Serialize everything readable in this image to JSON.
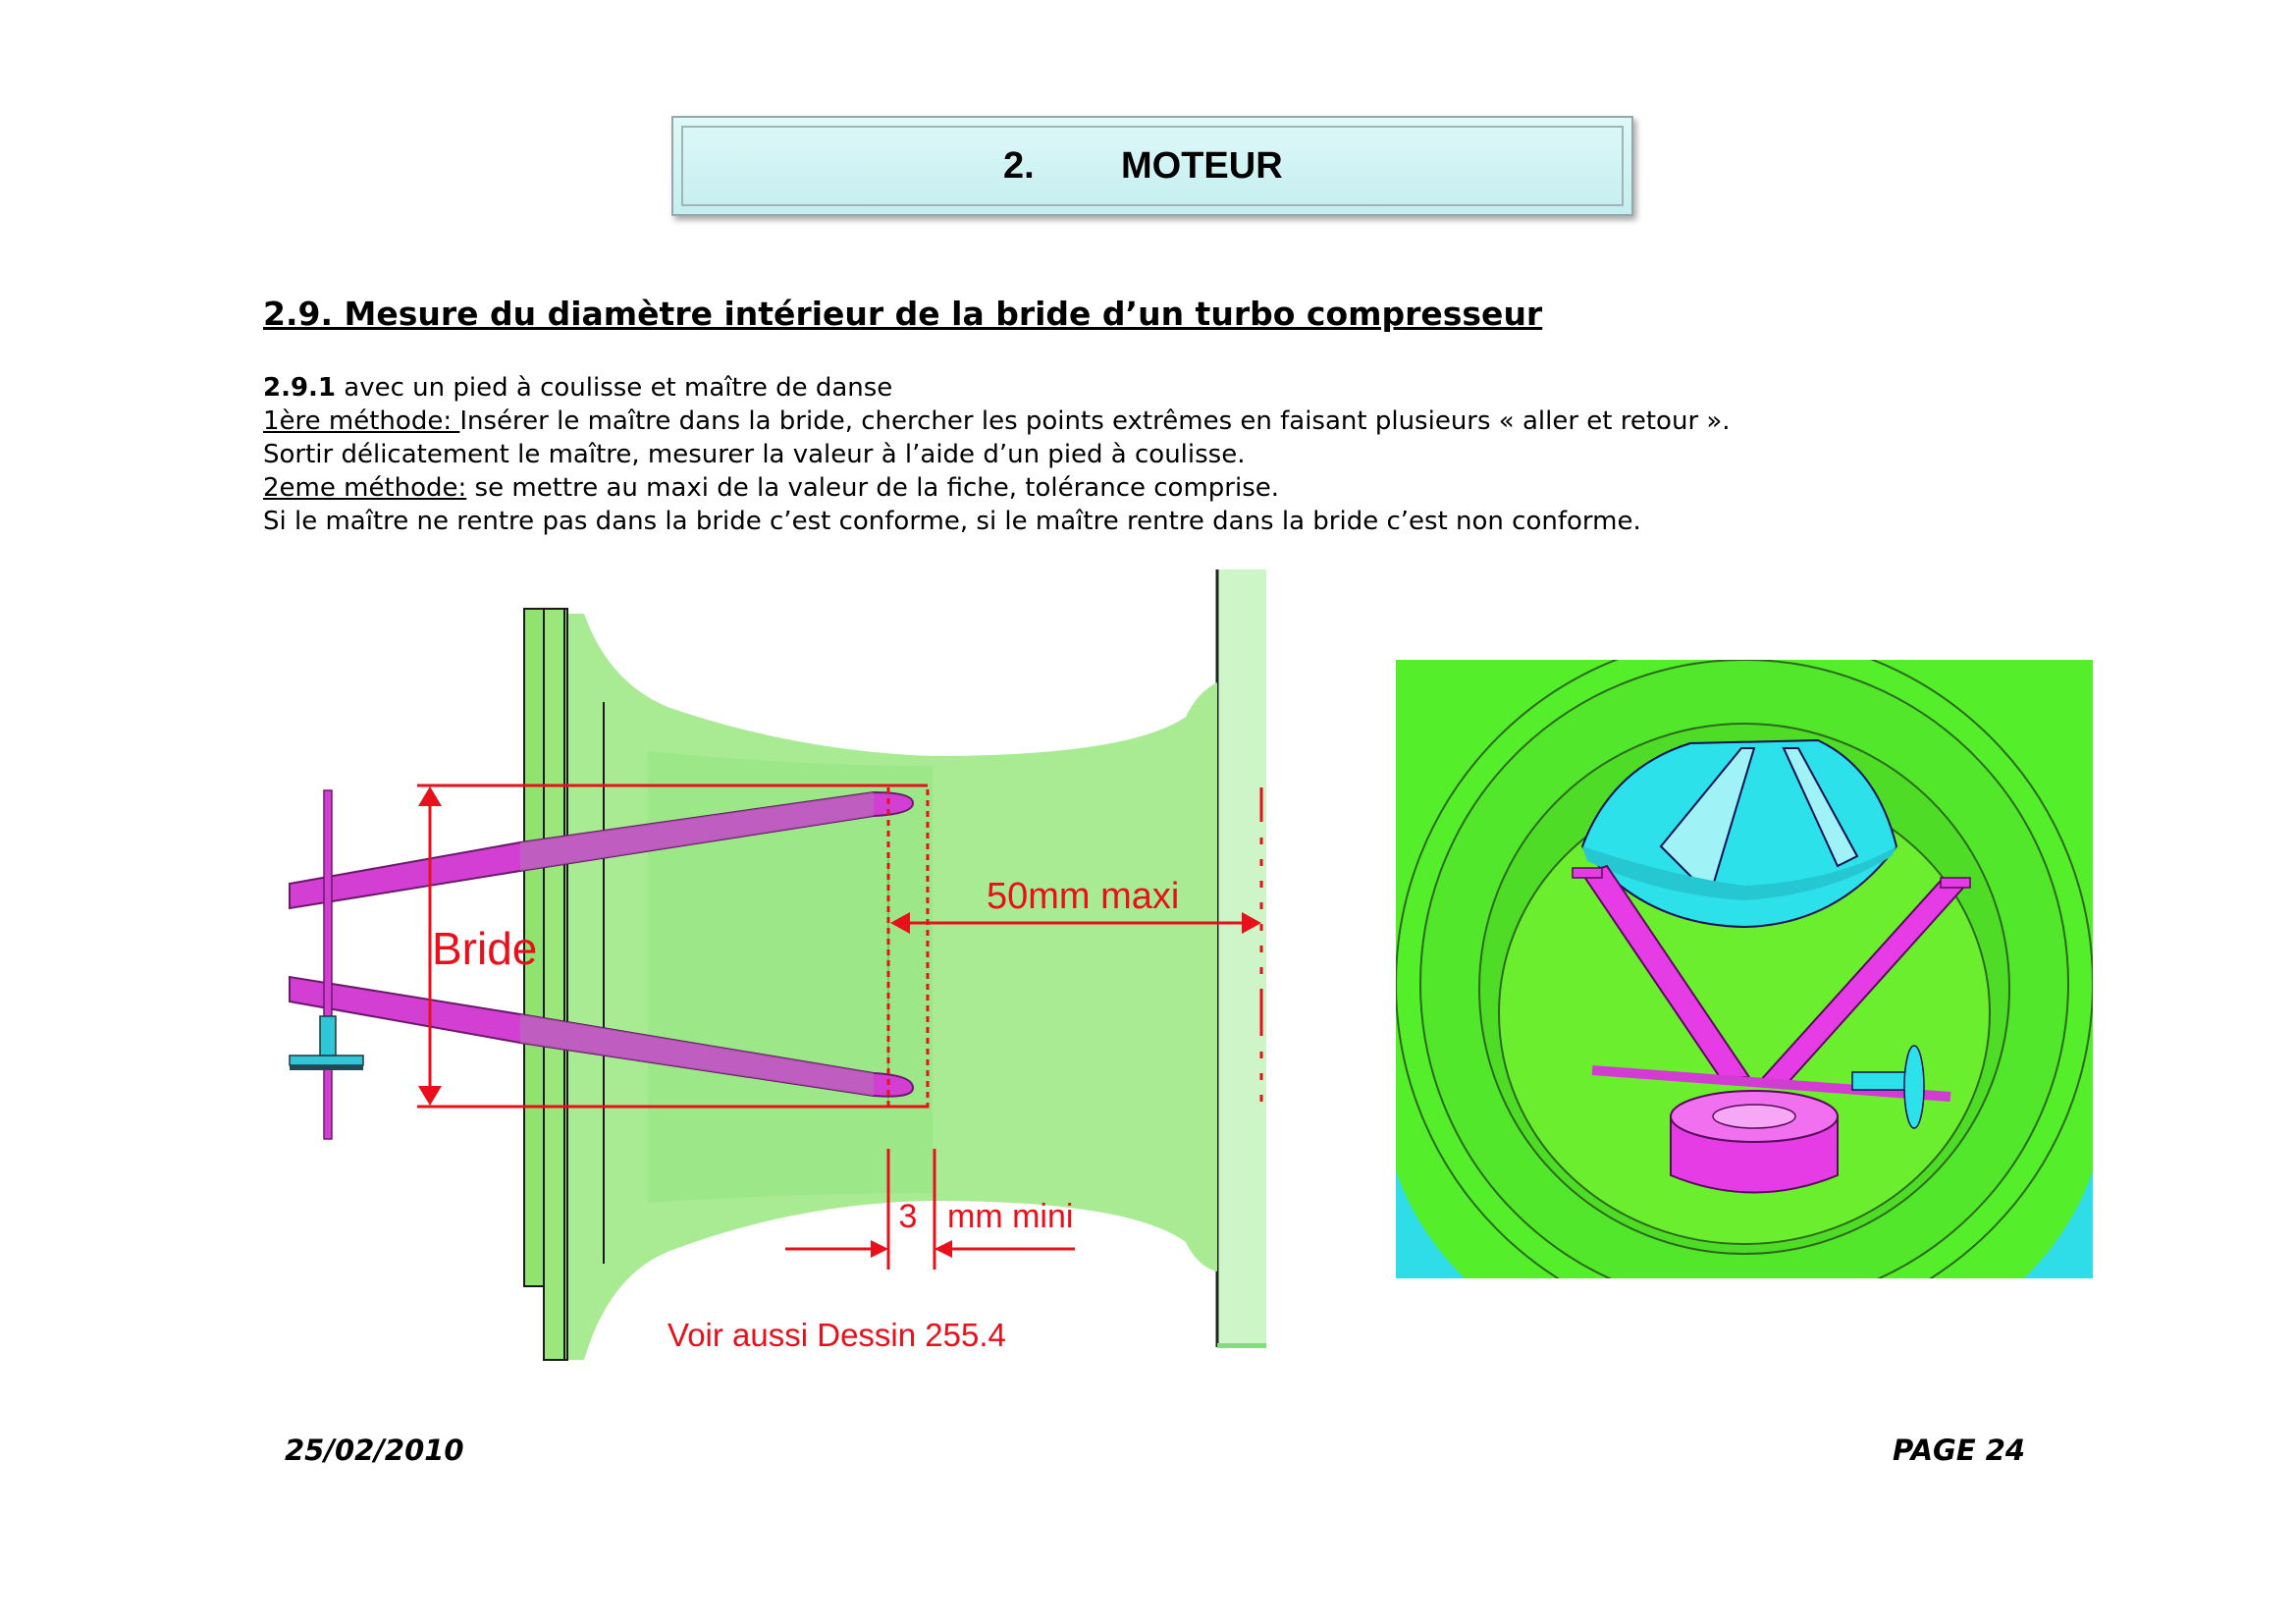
{
  "header": {
    "number": "2.",
    "title": "MOTEUR"
  },
  "section": {
    "title": "2.9. Mesure du diamètre intérieur de la bride d’un turbo compresseur"
  },
  "body": {
    "subsection_number": "2.9.1",
    "subsection_text": "avec un pied à coulisse et maître de danse",
    "method1_label": "1ère méthode: ",
    "method1_text": "Insérer le maître dans la bride, chercher les points extrêmes en faisant plusieurs « aller et retour ».",
    "line3": "Sortir délicatement le maître, mesurer la valeur à l’aide d’un pied à coulisse.",
    "method2_label": "2eme méthode:",
    "method2_text": " se mettre au maxi de la valeur de la fiche, tolérance comprise.",
    "line5": " Si le maître ne rentre pas dans la bride c’est conforme, si le maître rentre dans la bride c’est non conforme."
  },
  "diagram": {
    "bride_label": "Bride",
    "max_label": "50mm maxi",
    "min_number": "3",
    "min_label": "mm mini",
    "see_also": "Voir aussi Dessin 255.4",
    "colors": {
      "annotation": "#e8101a",
      "bride_green": "#86e86a",
      "gauge_magenta": "#d23fd2",
      "cyan": "#2fc7d6"
    }
  },
  "footer": {
    "date": "25/02/2010",
    "page": "PAGE 24"
  }
}
